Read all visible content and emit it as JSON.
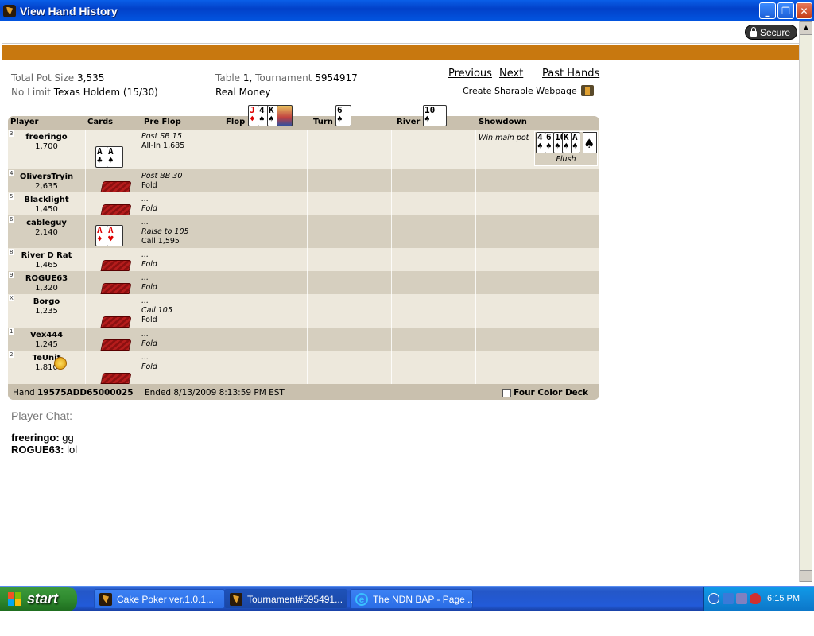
{
  "window": {
    "title": "View Hand History"
  },
  "secure_label": "Secure",
  "summary": {
    "pot_label": "Total Pot Size",
    "pot_value": "3,535",
    "limit_label": "No Limit",
    "game": "Texas Holdem",
    "stakes": "(15/30)",
    "table_label": "Table",
    "table_value": "1,",
    "tournament_label": "Tournament",
    "tournament_value": "5954917",
    "money": "Real Money"
  },
  "nav": {
    "previous": "Previous",
    "next": "Next",
    "past_hands": "Past Hands",
    "sharable": "Create Sharable Webpage"
  },
  "headers": {
    "player": "Player",
    "cards": "Cards",
    "preflop": "Pre Flop",
    "flop": "Flop",
    "turn": "Turn",
    "river": "River",
    "showdown": "Showdown"
  },
  "board": {
    "flop": [
      {
        "rank": "J",
        "suit": "♦",
        "red": true
      },
      {
        "rank": "4",
        "suit": "♠",
        "red": false
      },
      {
        "rank": "K",
        "suit": "♠",
        "red": false
      }
    ],
    "turn": {
      "rank": "6",
      "suit": "♠",
      "red": false
    },
    "river": {
      "rank": "10",
      "suit": "♠",
      "red": false
    }
  },
  "players": [
    {
      "seat": "3",
      "name": "freeringo",
      "chips": "1,700",
      "hole": [
        {
          "rank": "A",
          "suit": "♣"
        },
        {
          "rank": "A",
          "suit": "♠"
        }
      ],
      "actions": [
        "Post SB 15",
        "All-In 1,685"
      ]
    },
    {
      "seat": "4",
      "name": "OliversTryin",
      "chips": "2,635",
      "hole": null,
      "actions": [
        "Post BB 30",
        "Fold"
      ]
    },
    {
      "seat": "5",
      "name": "Blacklight",
      "chips": "1,450",
      "hole": null,
      "actions": [
        "...",
        "Fold"
      ]
    },
    {
      "seat": "6",
      "name": "cableguy",
      "chips": "2,140",
      "hole": [
        {
          "rank": "A",
          "suit": "♦"
        },
        {
          "rank": "A",
          "suit": "♥"
        }
      ],
      "actions": [
        "...",
        "Raise to 105",
        "Call 1,595"
      ]
    },
    {
      "seat": "8",
      "name": "River D Rat",
      "chips": "1,465",
      "hole": null,
      "actions": [
        "...",
        "Fold"
      ]
    },
    {
      "seat": "9",
      "name": "ROGUE63",
      "chips": "1,320",
      "hole": null,
      "actions": [
        "...",
        "Fold"
      ]
    },
    {
      "seat": "X",
      "name": "Borgo",
      "chips": "1,235",
      "hole": null,
      "actions": [
        "...",
        "Call 105",
        "Fold"
      ]
    },
    {
      "seat": "1",
      "name": "Vex444",
      "chips": "1,245",
      "hole": null,
      "actions": [
        "...",
        "Fold"
      ]
    },
    {
      "seat": "2",
      "name": "TeUnit",
      "chips": "1,810",
      "hole": null,
      "actions": [
        "...",
        "Fold"
      ]
    }
  ],
  "showdown": {
    "result": "Win main pot",
    "cards": [
      "4",
      "6",
      "10",
      "K",
      "A"
    ],
    "hand": "Flush"
  },
  "footer": {
    "hand_label": "Hand",
    "hand_id": "19575ADD65000025",
    "ended": "Ended 8/13/2009 8:13:59 PM EST",
    "four_color": "Four Color Deck"
  },
  "chat": {
    "title": "Player Chat:",
    "lines": [
      {
        "user": "freeringo:",
        "text": "gg"
      },
      {
        "user": "ROGUE63:",
        "text": "lol"
      }
    ]
  },
  "taskbar": {
    "start": "start",
    "tasks": [
      "Cake Poker ver.1.0.1...",
      "Tournament#595491...",
      "The NDN BAP - Page ..."
    ],
    "clock": "6:15 PM"
  }
}
